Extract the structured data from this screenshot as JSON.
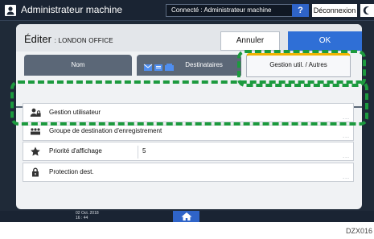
{
  "topbar": {
    "title": "Administrateur machine",
    "status": "Connecté : Administrateur machine",
    "help_label": "?",
    "logout_label": "Déconnexion"
  },
  "header": {
    "edit_title": "Éditer",
    "edit_subtitle": ": LONDON OFFICE",
    "cancel_label": "Annuler",
    "ok_label": "OK"
  },
  "tabs": [
    {
      "label": "Nom"
    },
    {
      "label": "Destinataires"
    },
    {
      "label": "Gestion util. / Autres",
      "selected": true
    }
  ],
  "rows": [
    {
      "label": "Gestion utilisateur",
      "icon": "user-lock-icon",
      "more": "..."
    },
    {
      "label": "Groupe de destination d'enregistrement",
      "icon": "group-icon",
      "more": "..."
    },
    {
      "label": "Priorité d'affichage",
      "icon": "star-icon",
      "value": "5",
      "more": "..."
    },
    {
      "label": "Protection dest.",
      "icon": "lock-icon",
      "more": "..."
    }
  ],
  "footer": {
    "date": "02 Oct. 2018",
    "time": "16 : 44"
  },
  "code": "DZX016",
  "colors": {
    "accent_blue": "#2f6fd6",
    "callout_green": "#1c9a3e",
    "tab_active_top": "#f0b400"
  }
}
